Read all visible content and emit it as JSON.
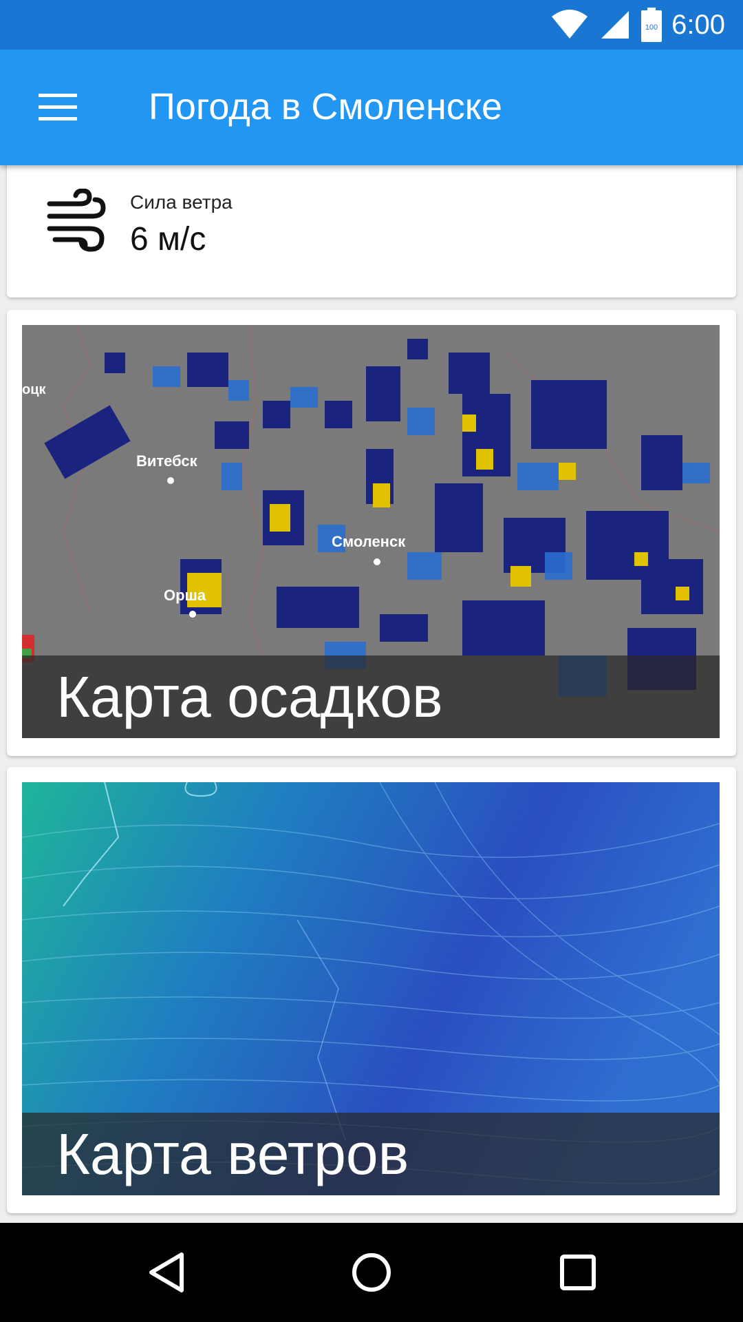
{
  "status_bar": {
    "time": "6:00",
    "battery_level": "100",
    "icons": [
      "wifi-icon",
      "cell-signal-icon",
      "battery-icon"
    ]
  },
  "app_bar": {
    "title": "Погода в Смоленске",
    "menu_icon": "hamburger-menu-icon",
    "background_color": "#2196f3",
    "status_color": "#1976d2"
  },
  "wind_card": {
    "icon": "wind-icon",
    "label": "Сила ветра",
    "value": "6 м/с"
  },
  "precip_map": {
    "caption": "Карта осадков",
    "cities": [
      "Витебск",
      "Смоленск",
      "Орша"
    ],
    "edge_labels": [
      "оцк"
    ]
  },
  "wind_map": {
    "caption": "Карта ветров"
  },
  "nav_bar": {
    "icons": [
      "back-icon",
      "home-icon",
      "recent-apps-icon"
    ]
  }
}
